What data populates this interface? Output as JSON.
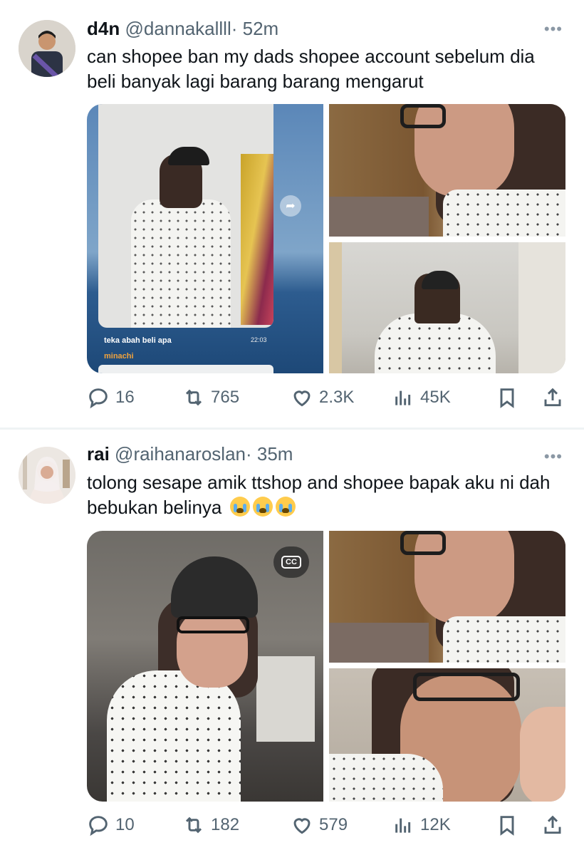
{
  "tweets": [
    {
      "name": "d4n",
      "handle": "@dannakallll",
      "time": "· 52m",
      "more": "•••",
      "text": "can shopee ban my dads shopee account sebelum dia beli banyak lagi barang barang mengarut",
      "media": {
        "chat_caption": "teka abah beli apa",
        "chat_time": "22:03",
        "chat_sender": "minachi"
      },
      "stats": {
        "replies": "16",
        "retweets": "765",
        "likes": "2.3K",
        "views": "45K"
      }
    },
    {
      "name": "rai",
      "handle": "@raihanaroslan",
      "time": "· 35m",
      "more": "•••",
      "text": "tolong sesape amik ttshop and shopee bapak aku ni dah bebukan belinya",
      "emojis": [
        "loudly-crying-face",
        "loudly-crying-face",
        "loudly-crying-face"
      ],
      "media": {
        "cc_label": "CC"
      },
      "stats": {
        "replies": "10",
        "retweets": "182",
        "likes": "579",
        "views": "12K"
      }
    }
  ],
  "icons": {
    "reply": "reply-icon",
    "retweet": "retweet-icon",
    "like": "heart-icon",
    "views": "views-icon",
    "bookmark": "bookmark-icon",
    "share": "share-icon"
  },
  "colors": {
    "text": "#0f1419",
    "secondary": "#536471",
    "divider": "#eff3f4"
  }
}
